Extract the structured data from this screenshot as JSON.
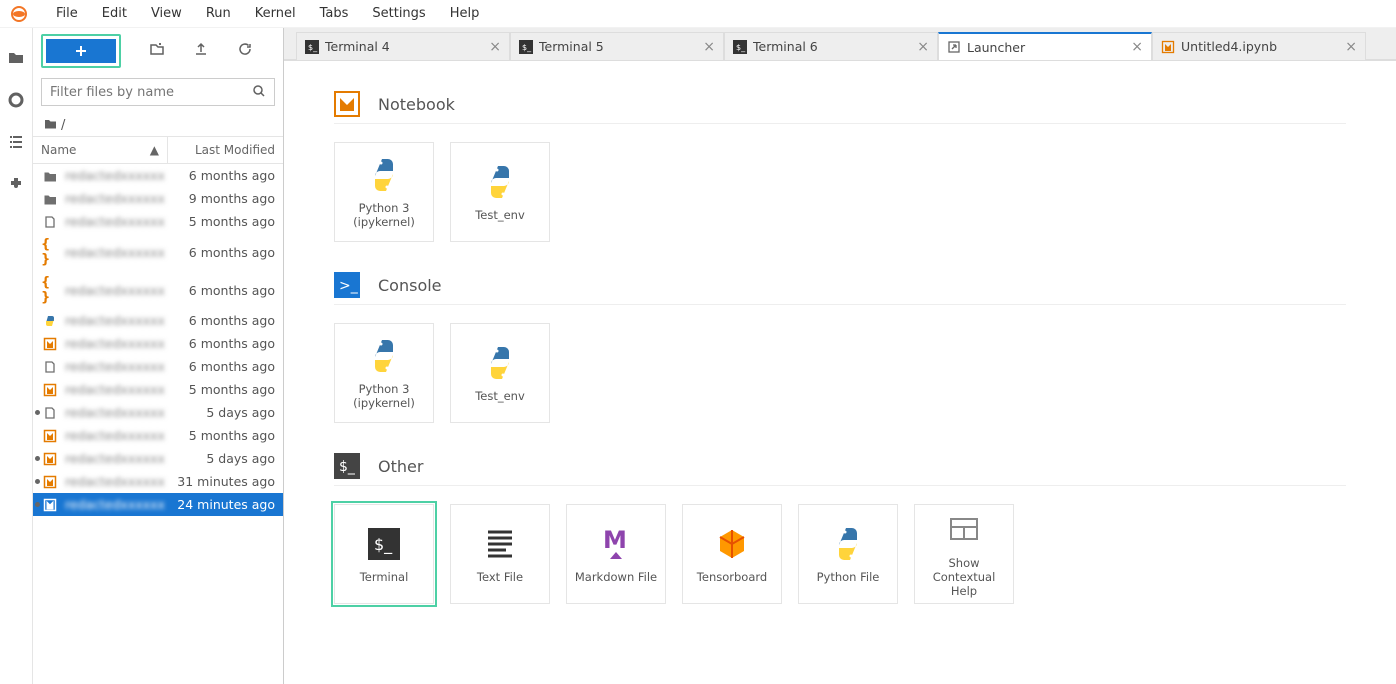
{
  "menu": {
    "items": [
      "File",
      "Edit",
      "View",
      "Run",
      "Kernel",
      "Tabs",
      "Settings",
      "Help"
    ]
  },
  "filebrowser": {
    "filter_placeholder": "Filter files by name",
    "breadcrumb_root": "/",
    "columns": {
      "name": "Name",
      "modified": "Last Modified"
    },
    "files": [
      {
        "icon": "folder",
        "name": "redacted",
        "modified": "6 months ago",
        "running": false,
        "selected": false
      },
      {
        "icon": "folder",
        "name": "redacted",
        "modified": "9 months ago",
        "running": false,
        "selected": false
      },
      {
        "icon": "file",
        "name": "redacted",
        "modified": "5 months ago",
        "running": false,
        "selected": false
      },
      {
        "icon": "json",
        "name": "redacted",
        "modified": "6 months ago",
        "running": false,
        "selected": false
      },
      {
        "icon": "json",
        "name": "redacted",
        "modified": "6 months ago",
        "running": false,
        "selected": false
      },
      {
        "icon": "py",
        "name": "redacted",
        "modified": "6 months ago",
        "running": false,
        "selected": false
      },
      {
        "icon": "nb",
        "name": "redacted",
        "modified": "6 months ago",
        "running": false,
        "selected": false
      },
      {
        "icon": "file",
        "name": "redacted",
        "modified": "6 months ago",
        "running": false,
        "selected": false
      },
      {
        "icon": "nb",
        "name": "redacted",
        "modified": "5 months ago",
        "running": false,
        "selected": false
      },
      {
        "icon": "file",
        "name": "redacted",
        "modified": "5 days ago",
        "running": true,
        "selected": false
      },
      {
        "icon": "nb",
        "name": "redacted",
        "modified": "5 months ago",
        "running": false,
        "selected": false
      },
      {
        "icon": "nb",
        "name": "redacted",
        "modified": "5 days ago",
        "running": true,
        "selected": false
      },
      {
        "icon": "nb",
        "name": "redacted",
        "modified": "31 minutes ago",
        "running": true,
        "selected": false
      },
      {
        "icon": "nb",
        "name": "redacted",
        "modified": "24 minutes ago",
        "running": true,
        "selected": true
      }
    ]
  },
  "tabs": [
    {
      "icon": "terminal",
      "label": "Terminal 4",
      "active": false
    },
    {
      "icon": "terminal",
      "label": "Terminal 5",
      "active": false
    },
    {
      "icon": "terminal",
      "label": "Terminal 6",
      "active": false
    },
    {
      "icon": "launcher",
      "label": "Launcher",
      "active": true
    },
    {
      "icon": "nb",
      "label": "Untitled4.ipynb",
      "active": false
    }
  ],
  "launcher": {
    "sections": [
      {
        "icon": "nb",
        "title": "Notebook",
        "cards": [
          {
            "icon": "python",
            "label1": "Python 3",
            "label2": "(ipykernel)"
          },
          {
            "icon": "python",
            "label1": "Test_env",
            "label2": ""
          }
        ]
      },
      {
        "icon": "console",
        "title": "Console",
        "cards": [
          {
            "icon": "python",
            "label1": "Python 3",
            "label2": "(ipykernel)"
          },
          {
            "icon": "python",
            "label1": "Test_env",
            "label2": ""
          }
        ]
      },
      {
        "icon": "other",
        "title": "Other",
        "cards": [
          {
            "icon": "terminal-card",
            "label1": "Terminal",
            "label2": "",
            "highlight": true
          },
          {
            "icon": "textfile",
            "label1": "Text File",
            "label2": ""
          },
          {
            "icon": "markdown",
            "label1": "Markdown File",
            "label2": ""
          },
          {
            "icon": "tensorboard",
            "label1": "Tensorboard",
            "label2": ""
          },
          {
            "icon": "pyfile",
            "label1": "Python File",
            "label2": ""
          },
          {
            "icon": "contexthelp",
            "label1": "Show Contextual",
            "label2": "Help"
          }
        ]
      }
    ]
  }
}
